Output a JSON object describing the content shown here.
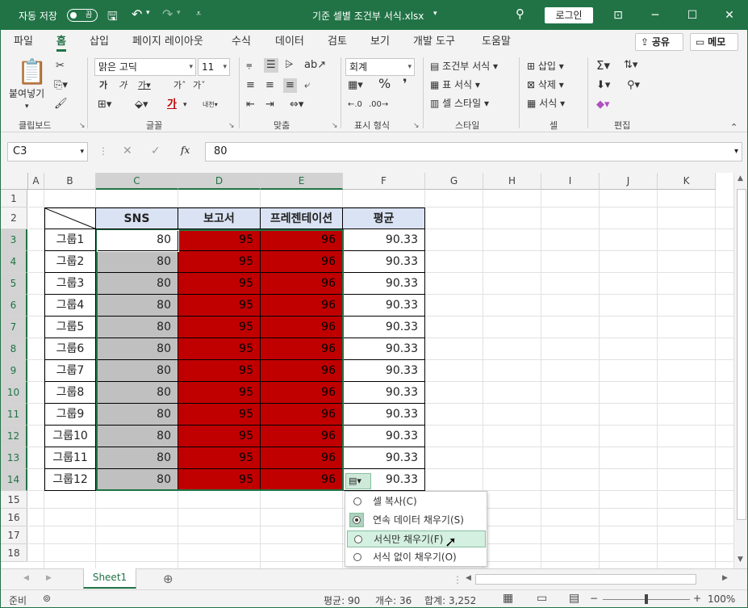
{
  "titlebar": {
    "autosave_label": "자동 저장",
    "autosave_state": "끔",
    "doc_title": "기준 셀별 조건부 서식.xlsx",
    "login": "로그인"
  },
  "tabs": [
    "파일",
    "홈",
    "삽입",
    "페이지 레이아웃",
    "수식",
    "데이터",
    "검토",
    "보기",
    "개발 도구",
    "도움말"
  ],
  "share": "공유",
  "memo": "메모",
  "ribbon": {
    "paste": "붙여넣기",
    "clipboard": "클립보드",
    "font_name": "맑은 고딕",
    "font_size": "11",
    "font_group": "글꼴",
    "align_group": "맞춤",
    "number_format": "회계",
    "number_group": "표시 형식",
    "cond_format": "조건부 서식",
    "table_format": "표 서식",
    "cell_style": "셀 스타일",
    "style_group": "스타일",
    "insert": "삽입",
    "delete": "삭제",
    "format": "서식",
    "cells_group": "셀",
    "edit_group": "편집",
    "ga": "가"
  },
  "formula": {
    "namebox": "C3",
    "value": "80",
    "fx": "fx"
  },
  "columns": [
    "A",
    "B",
    "C",
    "D",
    "E",
    "F",
    "G",
    "H",
    "I",
    "J",
    "K"
  ],
  "rows": [
    "1",
    "2",
    "3",
    "4",
    "5",
    "6",
    "7",
    "8",
    "9",
    "10",
    "11",
    "12",
    "13",
    "14",
    "15",
    "16",
    "17",
    "18"
  ],
  "table": {
    "headers": [
      "SNS",
      "보고서",
      "프레젠테이션",
      "평균"
    ],
    "rows": [
      {
        "name": "그룹1",
        "sns": "80",
        "report": "95",
        "pres": "96",
        "avg": "90.33"
      },
      {
        "name": "그룹2",
        "sns": "80",
        "report": "95",
        "pres": "96",
        "avg": "90.33"
      },
      {
        "name": "그룹3",
        "sns": "80",
        "report": "95",
        "pres": "96",
        "avg": "90.33"
      },
      {
        "name": "그룹4",
        "sns": "80",
        "report": "95",
        "pres": "96",
        "avg": "90.33"
      },
      {
        "name": "그룹5",
        "sns": "80",
        "report": "95",
        "pres": "96",
        "avg": "90.33"
      },
      {
        "name": "그룹6",
        "sns": "80",
        "report": "95",
        "pres": "96",
        "avg": "90.33"
      },
      {
        "name": "그룹7",
        "sns": "80",
        "report": "95",
        "pres": "96",
        "avg": "90.33"
      },
      {
        "name": "그룹8",
        "sns": "80",
        "report": "95",
        "pres": "96",
        "avg": "90.33"
      },
      {
        "name": "그룹9",
        "sns": "80",
        "report": "95",
        "pres": "96",
        "avg": "90.33"
      },
      {
        "name": "그룹10",
        "sns": "80",
        "report": "95",
        "pres": "96",
        "avg": "90.33"
      },
      {
        "name": "그룹11",
        "sns": "80",
        "report": "95",
        "pres": "96",
        "avg": "90.33"
      },
      {
        "name": "그룹12",
        "sns": "80",
        "report": "95",
        "pres": "96",
        "avg": "90.33"
      }
    ]
  },
  "popup": [
    "셀 복사(C)",
    "연속 데이터 채우기(S)",
    "서식만 채우기(F)",
    "서식 없이 채우기(O)"
  ],
  "sheet_tab": "Sheet1",
  "status": {
    "ready": "준비",
    "avg": "평균: 90",
    "count": "개수: 36",
    "sum": "합계: 3,252",
    "zoom": "100%"
  },
  "colors": {
    "brand": "#217346",
    "red_fill": "#c00000",
    "gray_fill": "#c0c0c0",
    "header_fill": "#dae3f3"
  }
}
